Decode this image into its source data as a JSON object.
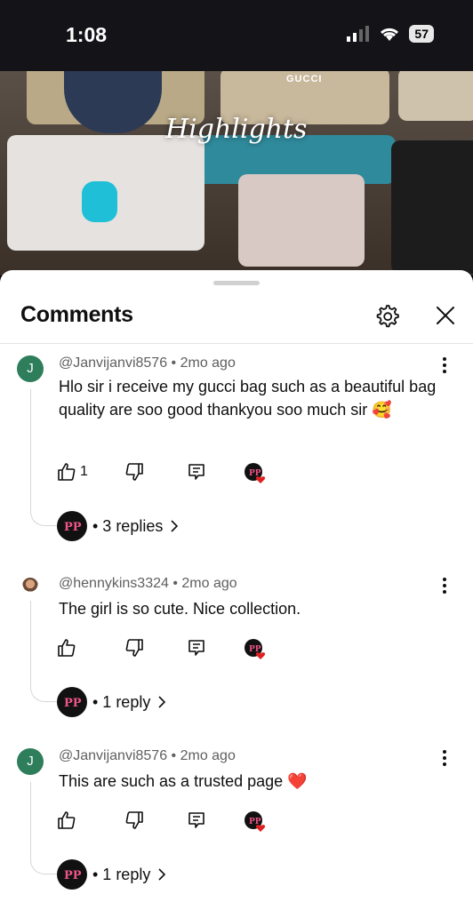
{
  "status": {
    "time": "1:08",
    "battery": "57"
  },
  "video": {
    "title": "Highlights",
    "brand_label": "GUCCI"
  },
  "sheet": {
    "title": "Comments"
  },
  "comments": [
    {
      "author": "@Janvijanvi8576",
      "age": "2mo ago",
      "meta": "@Janvijanvi8576 • 2mo ago",
      "avatar_letter": "J",
      "text": "Hlo sir i receive my gucci bag such as a beautiful bag quality are soo good thankyou soo much sir 🥰",
      "likes": "1",
      "replies": "• 3 replies"
    },
    {
      "author": "@hennykins3324",
      "age": "2mo ago",
      "meta": "@hennykins3324 • 2mo ago",
      "text": "The girl is so cute. Nice collection.",
      "likes": "",
      "replies": "• 1 reply"
    },
    {
      "author": "@Janvijanvi8576",
      "age": "2mo ago",
      "meta": "@Janvijanvi8576 • 2mo ago",
      "avatar_letter": "J",
      "text": "This are such as a trusted page ❤️",
      "likes": "",
      "replies": "• 1 reply"
    }
  ],
  "colors": {
    "avatar_green": "#2e7d5b",
    "heart_red": "#e02020",
    "status_bg": "#131318"
  },
  "icons": [
    "settings-icon",
    "close-icon",
    "thumbs-up-icon",
    "thumbs-down-icon",
    "reply-icon",
    "creator-heart-icon",
    "more-vert-icon",
    "chevron-right-icon"
  ]
}
